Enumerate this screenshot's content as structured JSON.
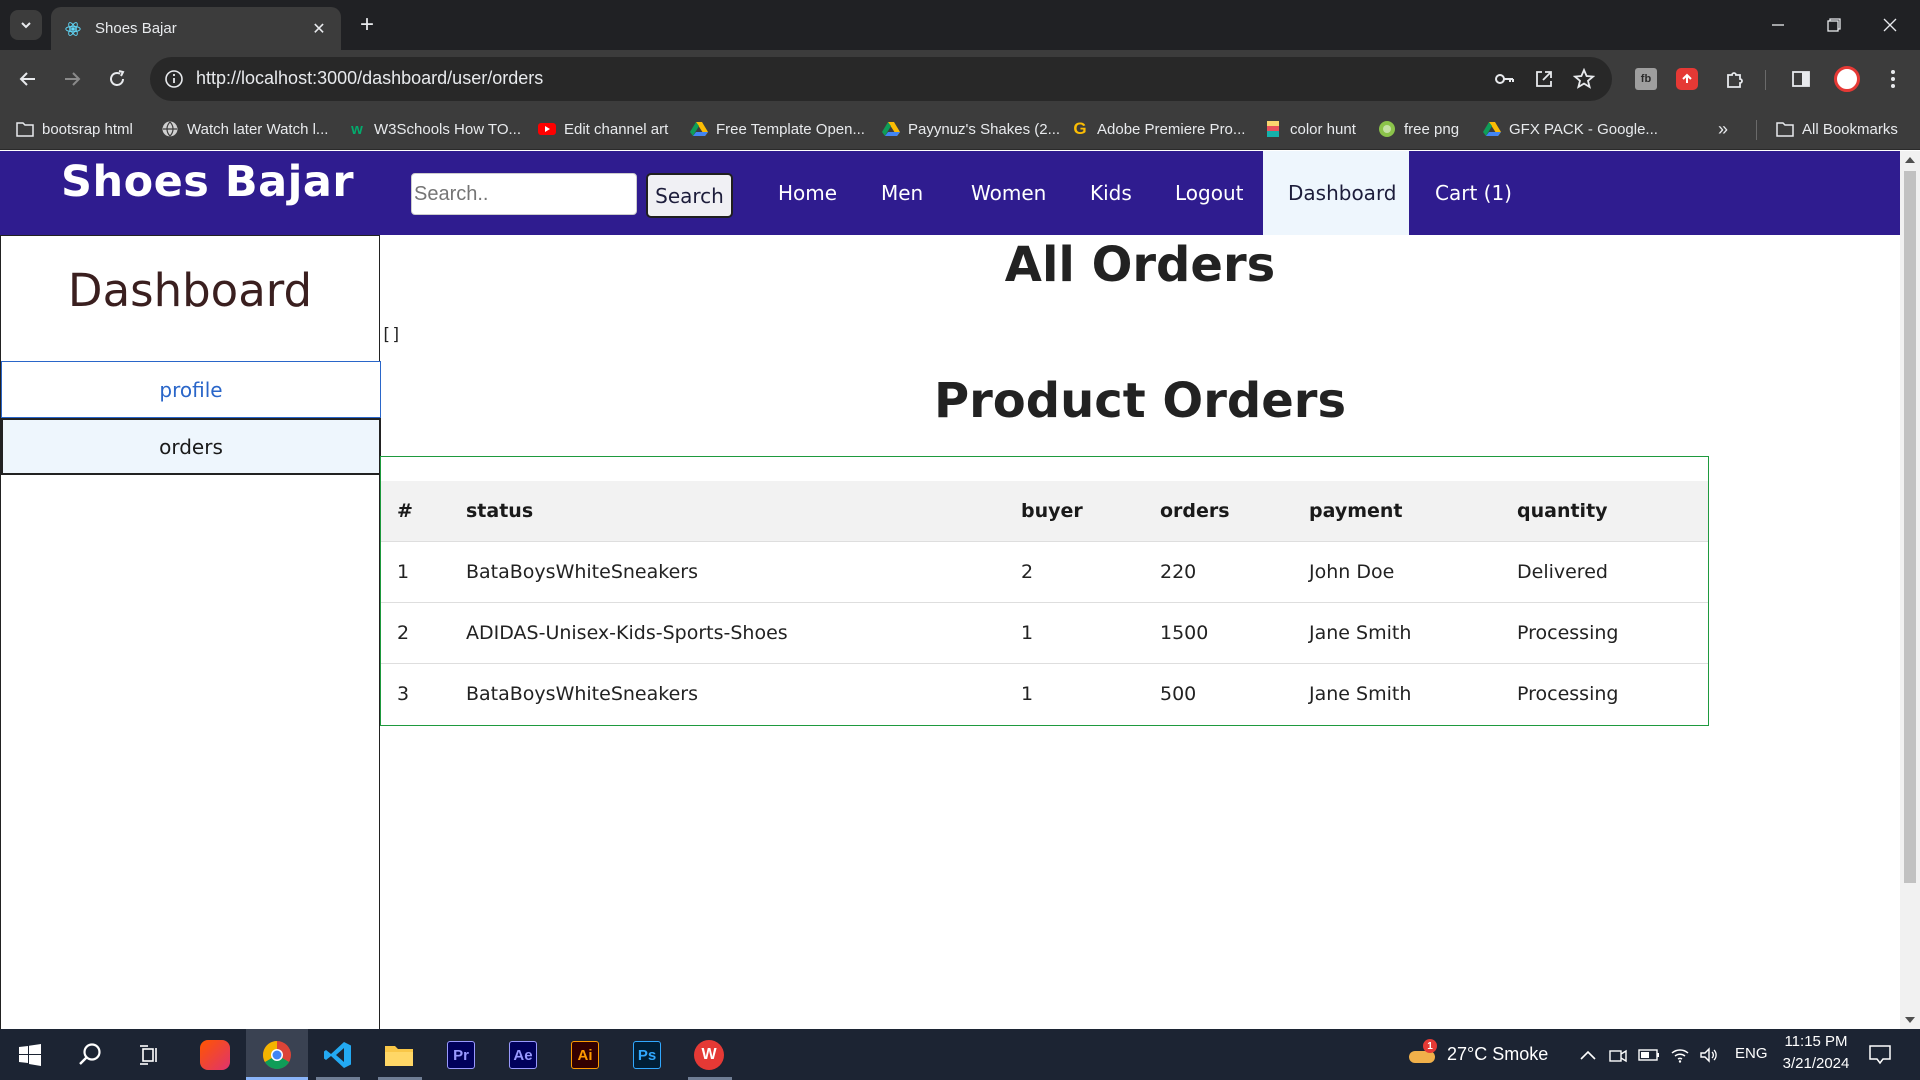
{
  "browser": {
    "tab_title": "Shoes Bajar",
    "url": "http://localhost:3000/dashboard/user/orders",
    "bookmarks": [
      {
        "label": "bootsrap html",
        "icon": "folder-icon"
      },
      {
        "label": "Watch later Watch l...",
        "icon": "globe-icon"
      },
      {
        "label": "W3Schools How TO...",
        "icon": "w3schools-icon"
      },
      {
        "label": "Edit channel art",
        "icon": "youtube-icon"
      },
      {
        "label": "Free Template Open...",
        "icon": "google-drive-icon"
      },
      {
        "label": "Payynuz's Shakes (2...",
        "icon": "google-drive-icon"
      },
      {
        "label": "Adobe Premiere Pro...",
        "icon": "google-g-icon"
      },
      {
        "label": "color hunt",
        "icon": "colorhunt-icon"
      },
      {
        "label": "free png",
        "icon": "freepng-icon"
      },
      {
        "label": "GFX PACK - Google...",
        "icon": "google-drive-icon"
      }
    ],
    "all_bookmarks": "All Bookmarks"
  },
  "site": {
    "brand": "Shoes Bajar",
    "search_placeholder": "Search..",
    "search_button": "Search",
    "nav": [
      "Home",
      "Men",
      "Women",
      "Kids",
      "Logout",
      "Dashboard",
      "Cart (1)"
    ],
    "active_nav": "Dashboard"
  },
  "sidebar": {
    "title": "Dashboard",
    "items": [
      "profile",
      "orders"
    ]
  },
  "main": {
    "title": "All Orders",
    "raw_output": "[]",
    "subtitle": "Product Orders",
    "table": {
      "headers": [
        "#",
        "status",
        "buyer",
        "orders",
        "payment",
        "quantity"
      ],
      "rows": [
        [
          "1",
          "BataBoysWhiteSneakers",
          "2",
          "220",
          "John Doe",
          "Delivered"
        ],
        [
          "2",
          "ADIDAS-Unisex-Kids-Sports-Shoes",
          "1",
          "1500",
          "Jane Smith",
          "Processing"
        ],
        [
          "3",
          "BataBoysWhiteSneakers",
          "1",
          "500",
          "Jane Smith",
          "Processing"
        ]
      ]
    }
  },
  "taskbar": {
    "weather": "27°C  Smoke",
    "weather_badge": "1",
    "language": "ENG",
    "time": "11:15 PM",
    "date": "3/21/2024"
  },
  "colors": {
    "site_nav_bg": "#2f1c8f",
    "active_nav_bg": "#eef6fd",
    "table_border": "#1e9a3e",
    "profile_link": "#2a66c9"
  }
}
